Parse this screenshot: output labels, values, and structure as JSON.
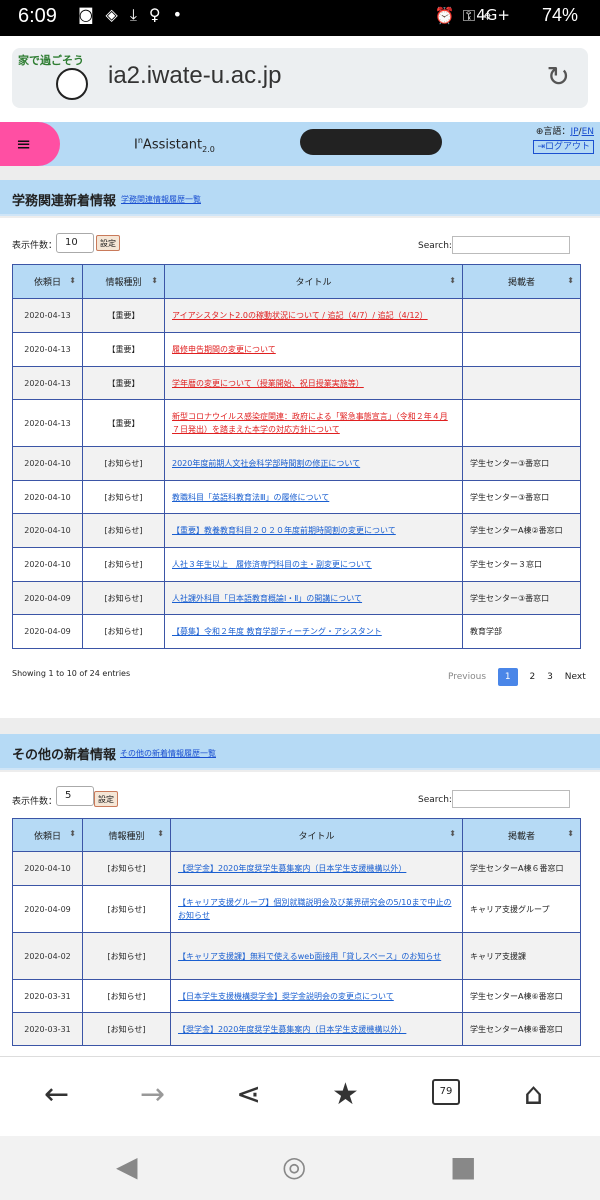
{
  "status": {
    "time": "6:09",
    "network": "4G+",
    "battery": "74%"
  },
  "browser": {
    "url": "ia2.iwate-u.ac.jp",
    "logo_text": "家で過ごそう",
    "tab_count": "79"
  },
  "header": {
    "brand_prefix": "I",
    "brand_sup": "n",
    "brand_main": "Assistant",
    "brand_sub": "2.0",
    "lang_label": "言語：",
    "lang_jp": "JP",
    "lang_sep": "/",
    "lang_en": "EN",
    "logout": "ログアウト",
    "menu_glyph": "≡"
  },
  "work": {
    "title": "学務関連新着情報",
    "history_link": "学務関連情報履歴一覧",
    "len_label": "表示件数：",
    "len_value": "10",
    "set_label": "設定",
    "search_label": "Search:",
    "columns": [
      "依頼日",
      "情報種別",
      "タイトル",
      "掲載者"
    ],
    "rows": [
      {
        "date": "2020-04-13",
        "cat": "【重要】",
        "title": "アイアシスタント2.0の稼動状況について / 追記（4/7）/ 追記（4/12）",
        "poster": ""
      },
      {
        "date": "2020-04-13",
        "cat": "【重要】",
        "title": "履修申告期間の変更について",
        "poster": ""
      },
      {
        "date": "2020-04-13",
        "cat": "【重要】",
        "title": "学年暦の変更について（授業開始、祝日授業実施等）",
        "poster": ""
      },
      {
        "date": "2020-04-13",
        "cat": "【重要】",
        "title": "新型コロナウイルス感染症関連：政府による「緊急事態宣言」（令和２年４月７日発出）を踏まえた本学の対応方針について",
        "poster": ""
      },
      {
        "date": "2020-04-10",
        "cat": "[お知らせ]",
        "title": "2020年度前期人文社会科学部時間割の修正について",
        "poster": "学生センター③番窓口"
      },
      {
        "date": "2020-04-10",
        "cat": "[お知らせ]",
        "title": "教職科目「英語科教育法Ⅲ」の履修について",
        "poster": "学生センター③番窓口"
      },
      {
        "date": "2020-04-10",
        "cat": "[お知らせ]",
        "title": "【重要】教養教育科目２０２０年度前期時間割の変更について",
        "poster": "学生センターA棟②番窓口"
      },
      {
        "date": "2020-04-10",
        "cat": "[お知らせ]",
        "title": "人社３年生以上　履修済専門科目の主・副変更について",
        "poster": "学生センター３窓口"
      },
      {
        "date": "2020-04-09",
        "cat": "[お知らせ]",
        "title": "人社課外科目「日本語教育概論Ⅰ・Ⅱ」の開講について",
        "poster": "学生センター③番窓口"
      },
      {
        "date": "2020-04-09",
        "cat": "[お知らせ]",
        "title": "【募集】令和２年度 教育学部ティーチング・アシスタント",
        "poster": "教育学部"
      }
    ],
    "info": "Showing 1 to 10 of 24 entries",
    "pager": {
      "prev": "Previous",
      "pages": [
        "1",
        "2",
        "3"
      ],
      "next": "Next"
    }
  },
  "other": {
    "title": "その他の新着情報",
    "history_link": "その他の新着情報履歴一覧",
    "len_label": "表示件数：",
    "len_value": "5",
    "set_label": "設定",
    "search_label": "Search:",
    "columns": [
      "依頼日",
      "情報種別",
      "タイトル",
      "掲載者"
    ],
    "rows": [
      {
        "date": "2020-04-10",
        "cat": "[お知らせ]",
        "title": "【奨学金】2020年度奨学生募集案内（日本学生支援機構以外）",
        "poster": "学生センターA棟６番窓口"
      },
      {
        "date": "2020-04-09",
        "cat": "[お知らせ]",
        "title": "【キャリア支援グループ】個別就職説明会及び業界研究会の5/10まで中止のお知らせ",
        "poster": "キャリア支援グループ"
      },
      {
        "date": "2020-04-02",
        "cat": "[お知らせ]",
        "title": "【キャリア支援課】無料で使えるweb面接用「貸しスペース」のお知らせ",
        "poster": "キャリア支援課"
      },
      {
        "date": "2020-03-31",
        "cat": "[お知らせ]",
        "title": "【日本学生支援機構奨学金】奨学金説明会の変更点について",
        "poster": "学生センターA棟⑥番窓口"
      },
      {
        "date": "2020-03-31",
        "cat": "[お知らせ]",
        "title": "【奨学金】2020年度奨学生募集案内（日本学生支援機構以外）",
        "poster": "学生センターA棟⑥番窓口"
      }
    ]
  },
  "colors": {
    "header_bg": "#b6daf5",
    "important": "#e02020",
    "link": "#1a5fd0",
    "menu_highlight": "#ff4fa3"
  }
}
